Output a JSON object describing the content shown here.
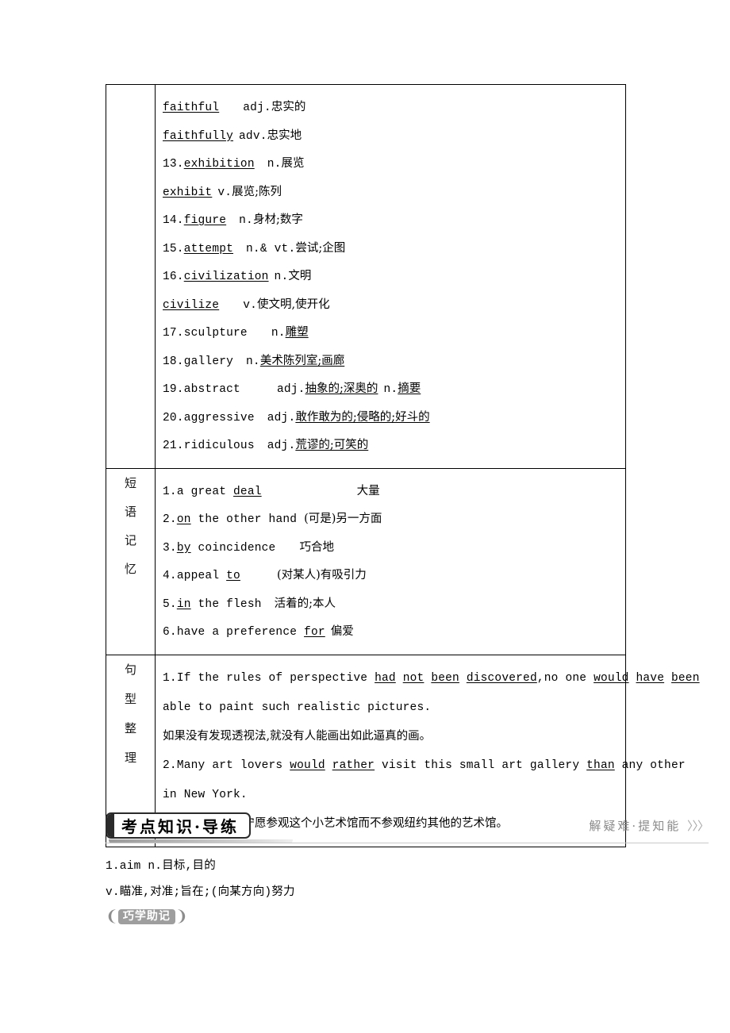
{
  "vocabulary": {
    "lines": [
      {
        "num": "",
        "word": "faithful",
        "word_underlined": true,
        "gap": "sp3",
        "pos": "adj.",
        "def": "忠实的",
        "def_underlined": false
      },
      {
        "num": "",
        "word": "faithfully",
        "word_underlined": true,
        "gap": "sp1",
        "pos": "adv.",
        "def": "忠实地",
        "def_underlined": false
      },
      {
        "num": "13.",
        "word": "exhibition",
        "word_underlined": true,
        "gap": "sp2",
        "pos": "n.",
        "def": "展览",
        "def_underlined": false
      },
      {
        "num": "",
        "word": "exhibit",
        "word_underlined": true,
        "gap": "sp1",
        "pos": "v.",
        "def": "展览;陈列",
        "def_underlined": false
      },
      {
        "num": "14.",
        "word": "figure",
        "word_underlined": true,
        "gap": "sp2",
        "pos": "n.",
        "def": "身材;数字",
        "def_underlined": false
      },
      {
        "num": "15.",
        "word": "attempt",
        "word_underlined": true,
        "gap": "sp2",
        "pos": "n.& vt.",
        "def": "尝试;企图",
        "def_underlined": false
      },
      {
        "num": "16.",
        "word": "civilization",
        "word_underlined": true,
        "gap": "sp1",
        "pos": "n.",
        "def": "文明",
        "def_underlined": false
      },
      {
        "num": "",
        "word": "civilize",
        "word_underlined": true,
        "gap": "sp3",
        "pos": "v.",
        "def": "使文明,使开化",
        "def_underlined": false
      },
      {
        "num": "17.",
        "word": "sculpture",
        "word_underlined": false,
        "gap": "sp3",
        "pos": "n.",
        "def": "雕塑",
        "def_underlined": true
      },
      {
        "num": "18.",
        "word": "gallery",
        "word_underlined": false,
        "gap": "sp2",
        "pos": "n.",
        "def": "美术陈列室;画廊",
        "def_underlined": true
      },
      {
        "num": "19.",
        "word": "abstract",
        "word_underlined": false,
        "gap": "sp4",
        "pos": "adj.",
        "def": "抽象的;深奥的",
        "def_underlined": true,
        "pos2": "n.",
        "def2": "摘要",
        "def2_underlined": true
      },
      {
        "num": "20.",
        "word": "aggressive",
        "word_underlined": false,
        "gap": "sp2",
        "pos": "adj.",
        "def": "敢作敢为的;侵略的;好斗的",
        "def_underlined": true
      },
      {
        "num": "21.",
        "word": "ridiculous",
        "word_underlined": false,
        "gap": "sp2",
        "pos": "adj.",
        "def": "荒谬的;可笑的",
        "def_underlined": true
      }
    ]
  },
  "phrases": {
    "label": "短语记忆",
    "label_chars": [
      "短",
      "语",
      "记",
      "忆"
    ],
    "lines": [
      {
        "num": "1.",
        "pre": "a great ",
        "key": "deal",
        "post": "",
        "gap": "sp6",
        "def": "大量"
      },
      {
        "num": "2.",
        "pre": "",
        "key": "on",
        "post": " the other hand ",
        "gap": "",
        "def": "(可是)另一方面"
      },
      {
        "num": "3.",
        "pre": "",
        "key": "by",
        "post": " coincidence",
        "gap": "sp3",
        "def": "巧合地"
      },
      {
        "num": "4.",
        "pre": "appeal ",
        "key": "to",
        "post": "",
        "gap": "sp4",
        "def": "(对某人)有吸引力"
      },
      {
        "num": "5.",
        "pre": "",
        "key": "in",
        "post": " the flesh",
        "gap": "sp2",
        "def": "活着的;本人"
      },
      {
        "num": "6.",
        "pre": "have a preference ",
        "key": "for",
        "post": "",
        "gap": "sp1",
        "def": "偏爱"
      }
    ]
  },
  "sentences": {
    "label": "句型整理",
    "label_chars": [
      "句",
      "型",
      "整",
      "理"
    ],
    "items": [
      {
        "num": "1.",
        "en_line1_parts": [
          {
            "t": "If the rules of perspective ",
            "u": false
          },
          {
            "t": "had",
            "u": true
          },
          {
            "t": " ",
            "u": false
          },
          {
            "t": "not",
            "u": true
          },
          {
            "t": " ",
            "u": false
          },
          {
            "t": "been",
            "u": true
          },
          {
            "t": " ",
            "u": false
          },
          {
            "t": "discovered",
            "u": true
          },
          {
            "t": ",no one ",
            "u": false
          },
          {
            "t": "would",
            "u": true
          },
          {
            "t": " ",
            "u": false
          },
          {
            "t": "have",
            "u": true
          },
          {
            "t": " ",
            "u": false
          },
          {
            "t": "been",
            "u": true
          }
        ],
        "en_line2": "able to paint such realistic pictures.",
        "cn": "如果没有发现透视法,就没有人能画出如此逼真的画。"
      },
      {
        "num": "2.",
        "en_line1_parts": [
          {
            "t": "Many art lovers ",
            "u": false
          },
          {
            "t": "would",
            "u": true
          },
          {
            "t": " ",
            "u": false
          },
          {
            "t": "rather",
            "u": true
          },
          {
            "t": " visit this small art gallery ",
            "u": false
          },
          {
            "t": "than",
            "u": true
          },
          {
            "t": " any other",
            "u": false
          }
        ],
        "en_line2": "in New York.",
        "cn": "许多艺术爱好者宁愿参观这个小艺术馆而不参观纽约其他的艺术馆。"
      }
    ]
  },
  "section": {
    "title": "考点知识·导练",
    "right_text": "解疑难·提知能",
    "chevrons": "〉〉〉"
  },
  "after": {
    "entry_line1": "1.aim n.目标,目的",
    "entry_line2": "v.瞄准,对准;旨在;(向某方向)努力",
    "tip_label": "巧学助记",
    "tip_left_bracket": "❨",
    "tip_right_bracket": "❩"
  }
}
